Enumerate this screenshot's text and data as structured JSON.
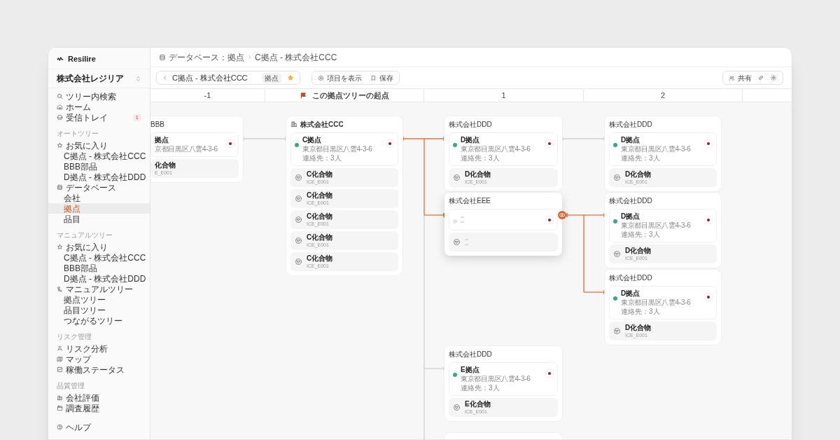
{
  "brand": "Resilire",
  "breadcrumb": [
    "データベース：拠点",
    "C拠点 - 株式会社CCC"
  ],
  "org": "株式会社レジリア",
  "sidebar": {
    "top": [
      {
        "label": "ツリー内検索"
      },
      {
        "label": "ホーム"
      },
      {
        "label": "受信トレイ",
        "badge": "1"
      }
    ],
    "sections": [
      {
        "title": "オートツリー",
        "items": [
          {
            "label": "お気に入り",
            "children": [
              {
                "label": "C拠点 - 株式会社CCC",
                "selected": false
              },
              {
                "label": "BBB部品",
                "selected": false
              },
              {
                "label": "D拠点 - 株式会社DDD",
                "selected": false
              }
            ]
          },
          {
            "label": "データベース",
            "children": [
              {
                "label": "会社",
                "selected": false
              },
              {
                "label": "拠点",
                "selected": true
              },
              {
                "label": "品目",
                "selected": false
              }
            ]
          }
        ]
      },
      {
        "title": "マニュアルツリー",
        "items": [
          {
            "label": "お気に入り",
            "children": [
              {
                "label": "C拠点 - 株式会社CCC",
                "selected": false
              },
              {
                "label": "BBB部品",
                "selected": false
              },
              {
                "label": "D拠点 - 株式会社DDD",
                "selected": false
              }
            ]
          },
          {
            "label": "マニュアルツリー",
            "children": [
              {
                "label": "拠点ツリー",
                "selected": false
              },
              {
                "label": "品目ツリー",
                "selected": false
              },
              {
                "label": "つながるツリー",
                "selected": false
              }
            ]
          }
        ]
      },
      {
        "title": "リスク管理",
        "items": [
          {
            "label": "リスク分析"
          },
          {
            "label": "マップ"
          },
          {
            "label": "稼働ステータス"
          }
        ]
      },
      {
        "title": "品質管理",
        "items": [
          {
            "label": "会社評価"
          },
          {
            "label": "調査履歴"
          }
        ]
      }
    ],
    "footer": {
      "label": "ヘルプ"
    }
  },
  "toolbar": {
    "back_label": "C拠点 - 株式会社CCC",
    "tag": "拠点",
    "favorite": true,
    "actions": [
      "項目を表示",
      "保存"
    ],
    "share": "共有"
  },
  "columns": [
    {
      "label": "-1",
      "origin": false
    },
    {
      "label": "この拠点ツリーの起点",
      "origin": true
    },
    {
      "label": "1",
      "origin": false
    },
    {
      "label": "2",
      "origin": false
    }
  ],
  "canvas": {
    "upstream": {
      "company": "BBB",
      "site": {
        "name": "拠点",
        "address": "京都目黒区八雲4-3-6"
      },
      "items": [
        {
          "name": "化合物",
          "code": "E_E001"
        }
      ]
    },
    "root": {
      "company": "株式会社CCC",
      "site": {
        "name": "C拠点",
        "address": "東京都目黒区八雲4-3-6",
        "contacts": "連絡先：3人",
        "color": "#3aa981"
      },
      "items": [
        {
          "name": "C化合物",
          "code": "ICE_E001"
        },
        {
          "name": "C化合物",
          "code": "ICE_E001"
        },
        {
          "name": "C化合物",
          "code": "ICE_E001"
        },
        {
          "name": "C化合物",
          "code": "ICE_E001"
        },
        {
          "name": "C化合物",
          "code": "ICE_E001"
        }
      ],
      "children": [
        {
          "company": "株式会社DDD",
          "highlighted": true,
          "focused": false,
          "site": {
            "name": "D拠点",
            "address": "東京都目黒区八雲4-3-6",
            "contacts": "連絡先：3人",
            "color": "#3aa981"
          },
          "items": [
            {
              "name": "D化合物",
              "code": "ICE_E001"
            }
          ],
          "children": [
            {
              "company": "株式会社DDD",
              "highlighted": false,
              "focused": false,
              "site": {
                "name": "D拠点",
                "address": "東京都目黒区八雲4-3-6",
                "contacts": "連絡先：3人",
                "color": "#3aa981"
              },
              "items": [
                {
                  "name": "D化合物",
                  "code": "ICE_E001"
                }
              ]
            }
          ]
        },
        {
          "company": "株式会社EEE",
          "highlighted": true,
          "focused": true,
          "site": {
            "kind": "loading",
            "color": "#e3e3e3"
          },
          "items": [
            {
              "kind": "loading"
            }
          ],
          "children": [
            {
              "company": "株式会社DDD",
              "highlighted": true,
              "focused": false,
              "site": {
                "name": "D拠点",
                "address": "東京都目黒区八雲4-3-6",
                "contacts": "連絡先：3人",
                "color": "#3aa981"
              },
              "items": [
                {
                  "name": "D化合物",
                  "code": "ICE_E001"
                }
              ]
            },
            {
              "company": "株式会社DDD",
              "highlighted": true,
              "focused": false,
              "site": {
                "name": "D拠点",
                "address": "東京都目黒区八雲4-3-6",
                "contacts": "連絡先：3人",
                "color": "#3aa981"
              },
              "items": [
                {
                  "name": "D化合物",
                  "code": "ICE_E001"
                }
              ]
            }
          ]
        },
        {
          "company": "株式会社DDD",
          "highlighted": false,
          "focused": false,
          "site": {
            "name": "E拠点",
            "address": "東京都目黒区八雲4-3-6",
            "contacts": "連絡先：3人",
            "color": "#3aa981"
          },
          "items": [
            {
              "name": "E化合物",
              "code": "ICE_E001"
            }
          ]
        },
        {
          "kind": "partial",
          "highlighted": false
        }
      ]
    }
  }
}
